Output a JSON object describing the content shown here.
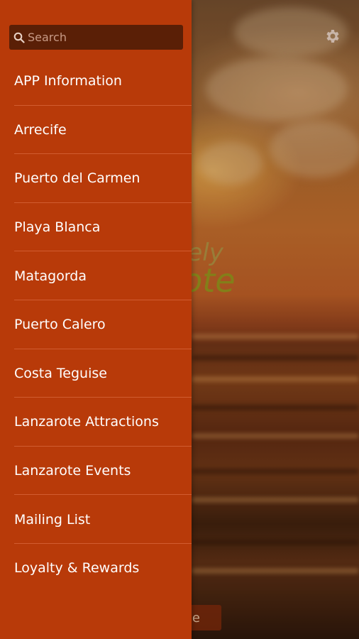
{
  "background": {
    "brand_line1": "lutely",
    "brand_line2": "arote",
    "bottom_button_label": "e",
    "settings_icon": "gear-icon"
  },
  "drawer": {
    "search": {
      "placeholder": "Search",
      "value": "",
      "icon": "search-icon"
    },
    "items": [
      {
        "label": "APP Information"
      },
      {
        "label": "Arrecife"
      },
      {
        "label": "Puerto del Carmen"
      },
      {
        "label": "Playa Blanca"
      },
      {
        "label": "Matagorda"
      },
      {
        "label": "Puerto Calero"
      },
      {
        "label": "Costa Teguise"
      },
      {
        "label": "Lanzarote Attractions"
      },
      {
        "label": "Lanzarote Events"
      },
      {
        "label": "Mailing List"
      },
      {
        "label": "Loyalty & Rewards"
      }
    ]
  },
  "colors": {
    "drawer_bg": "#b83a09",
    "search_bg": "#5a1f06",
    "text": "#ffffff",
    "brand_text": "#8f8a1c"
  }
}
